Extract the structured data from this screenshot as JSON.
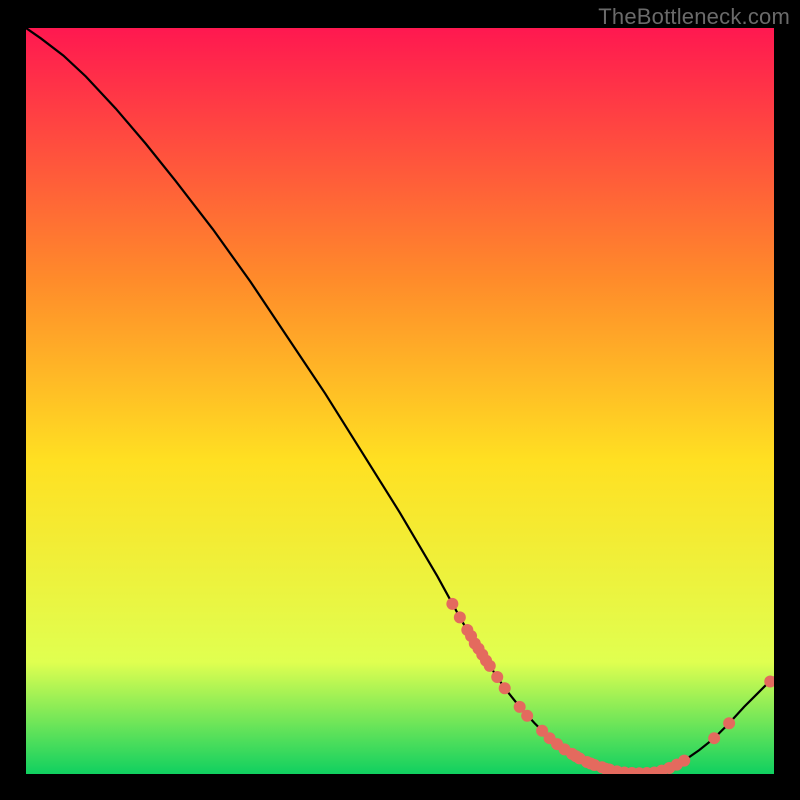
{
  "watermark": "TheBottleneck.com",
  "chart_data": {
    "type": "line",
    "title": "",
    "xlabel": "",
    "ylabel": "",
    "xlim": [
      0,
      100
    ],
    "ylim": [
      0,
      100
    ],
    "background_gradient": {
      "top": "#ff1850",
      "mid1": "#ff8c2a",
      "mid2": "#ffe022",
      "mid3": "#e0ff50",
      "bottom": "#10d060"
    },
    "series": [
      {
        "name": "curve",
        "type": "line",
        "color": "#000000",
        "x": [
          0,
          2,
          5,
          8,
          12,
          16,
          20,
          25,
          30,
          35,
          40,
          45,
          50,
          55,
          58,
          60,
          62,
          64,
          66,
          68,
          70,
          72,
          74,
          76,
          78,
          80,
          82,
          84,
          86,
          88,
          90,
          92,
          94,
          96,
          98,
          100
        ],
        "y": [
          100,
          98.6,
          96.3,
          93.5,
          89.2,
          84.5,
          79.5,
          73.0,
          66.0,
          58.5,
          51.0,
          43.0,
          35.0,
          26.5,
          21.0,
          17.5,
          14.5,
          11.5,
          9.0,
          6.8,
          4.8,
          3.3,
          2.1,
          1.2,
          0.6,
          0.2,
          0.1,
          0.2,
          0.8,
          1.8,
          3.2,
          4.8,
          6.8,
          9.0,
          11.0,
          13.0
        ]
      },
      {
        "name": "markers",
        "type": "scatter",
        "color": "#e46a5e",
        "x": [
          57,
          58,
          59,
          59.5,
          60,
          60.5,
          61,
          61.5,
          62,
          63,
          64,
          66,
          67,
          69,
          70,
          71,
          72,
          73,
          73.5,
          74,
          75,
          75.5,
          76,
          77,
          77.5,
          78,
          79,
          80,
          81,
          82,
          83,
          84,
          85,
          86,
          87,
          88,
          92,
          94,
          99.5
        ],
        "y": [
          22.8,
          21.0,
          19.3,
          18.5,
          17.5,
          16.8,
          16.0,
          15.2,
          14.5,
          13.0,
          11.5,
          9.0,
          7.8,
          5.8,
          4.8,
          4.0,
          3.3,
          2.7,
          2.4,
          2.1,
          1.6,
          1.4,
          1.2,
          0.9,
          0.7,
          0.6,
          0.35,
          0.2,
          0.13,
          0.1,
          0.13,
          0.2,
          0.45,
          0.8,
          1.25,
          1.8,
          4.8,
          6.8,
          12.4
        ]
      }
    ]
  }
}
